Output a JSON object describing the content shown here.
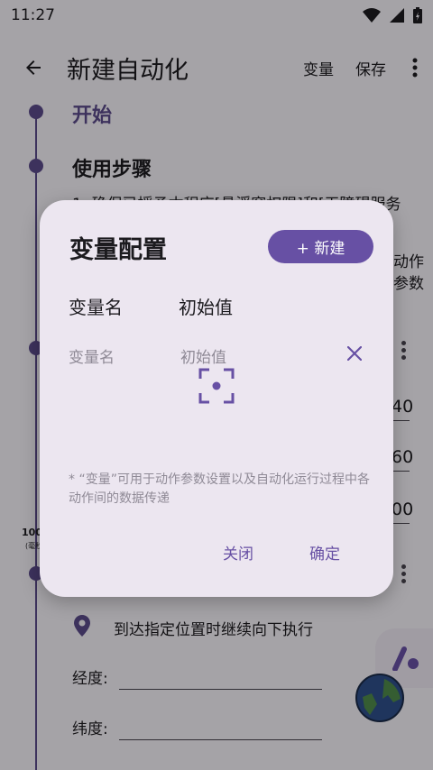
{
  "status_bar": {
    "time": "11:27"
  },
  "app_bar": {
    "title": "新建自动化",
    "action_variables": "变量",
    "action_save": "保存"
  },
  "background": {
    "section_start": "开始",
    "section_steps": "使用步骤",
    "steps_line": "1. 确保已授予本程序[悬浮窗权限]和[无障碍服务",
    "right_frag_1": "动作",
    "right_frag_2": "参数",
    "value_1": "40",
    "value_2": "60",
    "value_3": "00",
    "left_small_1": "100",
    "left_small_2": "(毫秒)",
    "location_text": "到达指定位置时继续向下执行",
    "longitude_label": "经度:",
    "latitude_label": "纬度:"
  },
  "dialog": {
    "title": "变量配置",
    "new_button": "+ 新建",
    "col_name": "变量名",
    "col_initial": "初始值",
    "name_placeholder": "变量名",
    "initial_placeholder": "初始值",
    "note": "* “变量”可用于动作参数设置以及自动化运行过程中各动作间的数据传递",
    "close_button": "关闭",
    "confirm_button": "确定"
  },
  "colors": {
    "accent": "#6750a4",
    "timeline": "#5b4a8a",
    "dialog_bg": "#ece6f0",
    "placeholder": "#8f8a96"
  }
}
